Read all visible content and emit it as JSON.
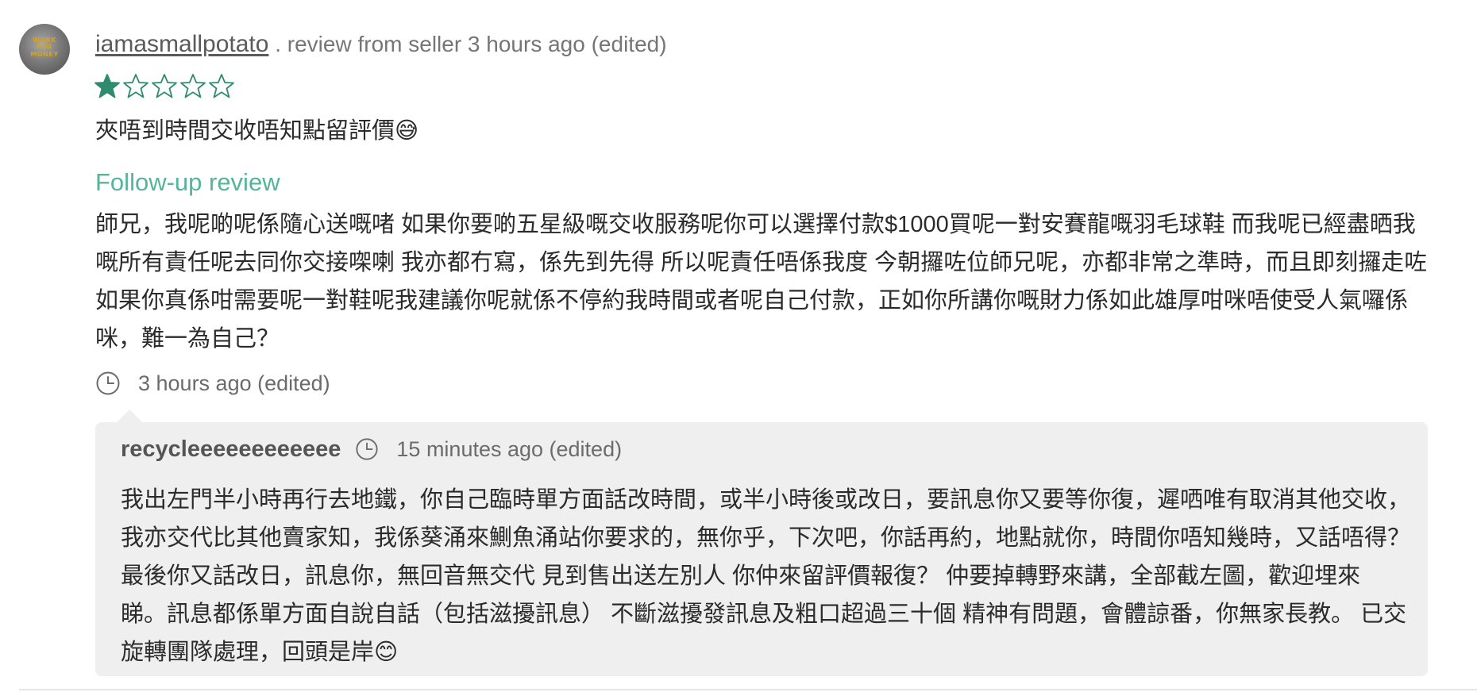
{
  "review": {
    "avatar": {
      "text": "WORK FOR MONEY",
      "icon": "avatar-image"
    },
    "username": "iamasmallpotato",
    "meta": " . review from seller 3 hours ago (edited)",
    "rating": {
      "value": 1,
      "max": 5,
      "color": "#2e8b6e"
    },
    "text": "夾唔到時間交收唔知點留評價😅",
    "followup_title": "Follow-up review",
    "followup_text": "師兄，我呢啲呢係隨心送嘅啫 如果你要啲五星級嘅交收服務呢你可以選擇付款$1000買呢一對安賽龍嘅羽毛球鞋 而我呢已經盡晒我嘅所有責任呢去同你交接㗎喇 我亦都冇寫，係先到先得 所以呢責任唔係我度 今朝攞咗位師兄呢，亦都非常之準時，而且即刻攞走咗 如果你真係咁需要呢一對鞋呢我建議你呢就係不停約我時間或者呢自己付款，正如你所講你嘅財力係如此雄厚咁咪唔使受人氣囉係咪，難一為自己？",
    "followup_time": "3 hours ago (edited)"
  },
  "reply": {
    "username": "recycleeeeeeeeeeee",
    "time": "15 minutes ago (edited)",
    "text": "我出左門半小時再行去地鐵，你自己臨時單方面話改時間，或半小時後或改日，要訊息你又要等你復，遲哂唯有取消其他交收，我亦交代比其他賣家知，我係葵涌來鰂魚涌站你要求的，無你乎，下次吧，你話再約，地點就你，時間你唔知幾時，又話唔得？最後你又話改日，訊息你，無回音無交代 見到售出送左別人 你仲來留評價報復？ 仲要掉轉野來講，全部截左圖，歡迎埋來 睇。訊息都係單方面自說自話（包括滋擾訊息） 不斷滋擾發訊息及粗口超過三十個 精神有問題，會體諒番，你無家長教。 已交旋轉團隊處理，回頭是岸😊"
  },
  "colors": {
    "accent": "#54b59a",
    "star": "#2e8b6e",
    "reply_bg": "#efefef",
    "text": "#2b2b2b",
    "muted": "#6b6b6b"
  }
}
